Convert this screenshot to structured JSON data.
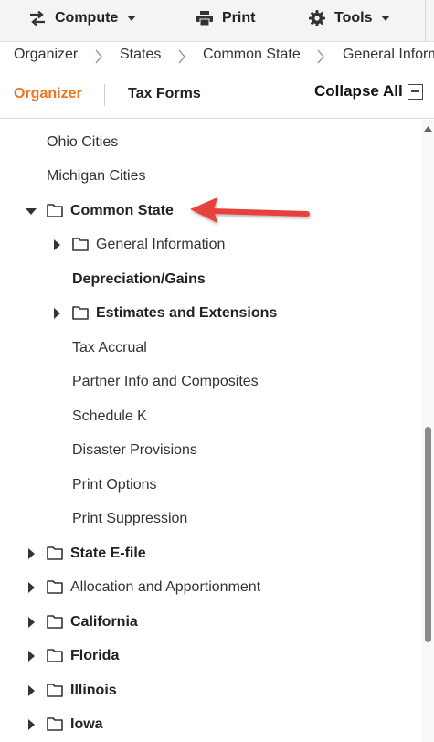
{
  "toolbar": {
    "compute_label": "Compute",
    "print_label": "Print",
    "tools_label": "Tools"
  },
  "breadcrumb": {
    "items": [
      "Organizer",
      "States",
      "Common State",
      "General Information"
    ]
  },
  "tabs": {
    "organizer": "Organizer",
    "tax_forms": "Tax Forms",
    "collapse_all": "Collapse All"
  },
  "tree": {
    "items": [
      {
        "label": "Ohio Cities",
        "bold": false,
        "caret": "none",
        "folder": false,
        "level": 1
      },
      {
        "label": "Michigan Cities",
        "bold": false,
        "caret": "none",
        "folder": false,
        "level": 1
      },
      {
        "label": "Common State",
        "bold": true,
        "caret": "down",
        "folder": true,
        "level": 0
      },
      {
        "label": "General Information",
        "bold": false,
        "caret": "right",
        "folder": true,
        "level": 1
      },
      {
        "label": "Depreciation/Gains",
        "bold": true,
        "caret": "none",
        "folder": false,
        "level": 2
      },
      {
        "label": "Estimates and Extensions",
        "bold": true,
        "caret": "right",
        "folder": true,
        "level": 1
      },
      {
        "label": "Tax Accrual",
        "bold": false,
        "caret": "none",
        "folder": false,
        "level": 2
      },
      {
        "label": "Partner Info and Composites",
        "bold": false,
        "caret": "none",
        "folder": false,
        "level": 2
      },
      {
        "label": "Schedule K",
        "bold": false,
        "caret": "none",
        "folder": false,
        "level": 2
      },
      {
        "label": "Disaster Provisions",
        "bold": false,
        "caret": "none",
        "folder": false,
        "level": 2
      },
      {
        "label": "Print Options",
        "bold": false,
        "caret": "none",
        "folder": false,
        "level": 2
      },
      {
        "label": "Print Suppression",
        "bold": false,
        "caret": "none",
        "folder": false,
        "level": 2
      },
      {
        "label": "State E-file",
        "bold": true,
        "caret": "right",
        "folder": true,
        "level": 0
      },
      {
        "label": "Allocation and Apportionment",
        "bold": false,
        "caret": "right",
        "folder": true,
        "level": 0
      },
      {
        "label": "California",
        "bold": true,
        "caret": "right",
        "folder": true,
        "level": 0
      },
      {
        "label": "Florida",
        "bold": true,
        "caret": "right",
        "folder": true,
        "level": 0
      },
      {
        "label": "Illinois",
        "bold": true,
        "caret": "right",
        "folder": true,
        "level": 0
      },
      {
        "label": "Iowa",
        "bold": true,
        "caret": "right",
        "folder": true,
        "level": 0
      }
    ]
  },
  "colors": {
    "accent": "#e87722",
    "annotation_arrow": "#e8413c"
  },
  "icons": {
    "compute": "swap-arrows-icon",
    "print": "printer-icon",
    "tools": "gear-icon",
    "folder": "folder-icon"
  }
}
